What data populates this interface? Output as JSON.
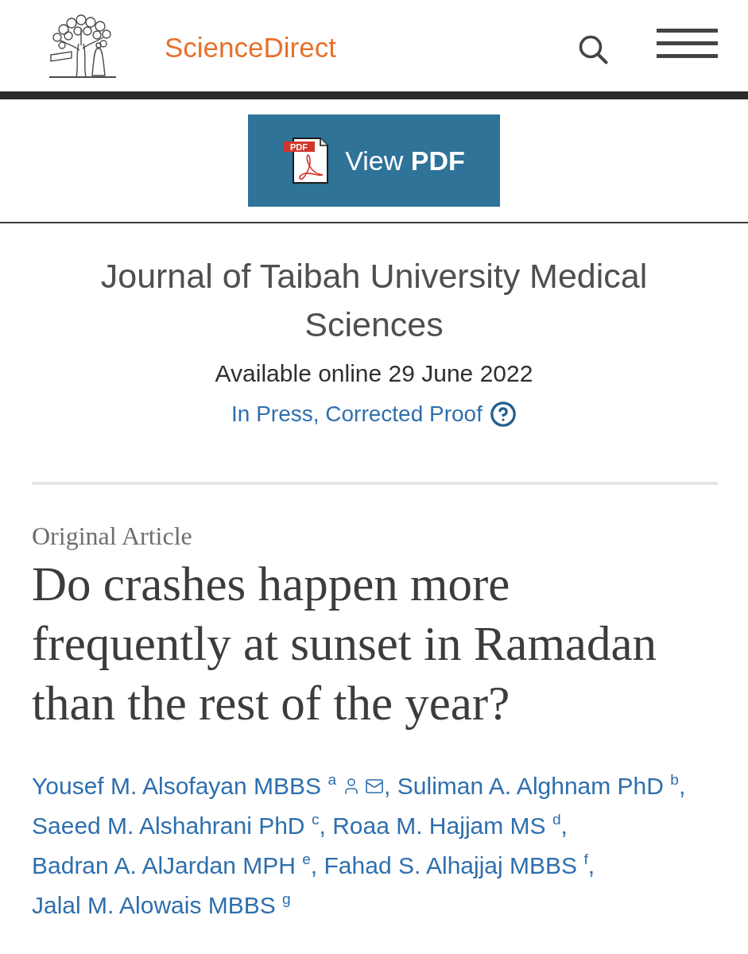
{
  "header": {
    "brand": "ScienceDirect"
  },
  "pdf_button": {
    "icon_label": "PDF",
    "label": "View **PDF**"
  },
  "journal": {
    "title": "Journal of Taibah University Medical Sciences",
    "availability": "Available online 29 June 2022",
    "status": "In Press, Corrected Proof"
  },
  "article": {
    "type": "Original Article",
    "title": "Do crashes happen more frequently at sunset in Ramadan than the rest of the year?",
    "authors": [
      {
        "name": "Yousef M. Alsofayan MBBS $^{a}$",
        "corresponding": true,
        "separator": ","
      },
      {
        "name": "Suliman A. Alghnam PhD $^{b}$",
        "corresponding": false,
        "separator": ","
      },
      {
        "name": "Saeed M. Alshahrani PhD $^{c}$",
        "corresponding": false,
        "separator": ","
      },
      {
        "name": "Roaa M. Hajjam MS $^{d}$",
        "corresponding": false,
        "separator": ","
      },
      {
        "name": "Badran A. AlJardan MPH $^{e}$",
        "corresponding": false,
        "separator": ","
      },
      {
        "name": "Fahad S. Alhajjaj MBBS $^{f}$",
        "corresponding": false,
        "separator": ","
      },
      {
        "name": "Jalal M. Alowais MBBS $^{g}$",
        "corresponding": false
      }
    ]
  }
}
